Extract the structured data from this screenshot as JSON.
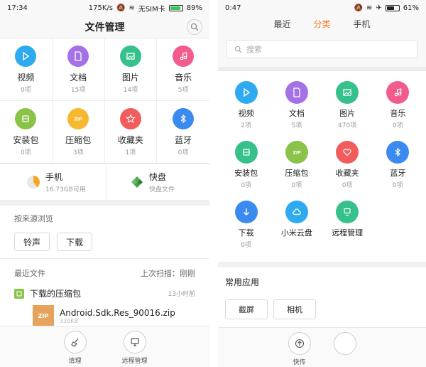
{
  "left": {
    "status": {
      "time": "17:34",
      "speed": "175K/s",
      "sim": "无SIM卡",
      "battery": "89%",
      "battery_level": 0.89
    },
    "header": {
      "title": "文件管理"
    },
    "categories": [
      {
        "label": "视频",
        "count": "0项",
        "icon": "play-icon",
        "color": "#2eaaf0"
      },
      {
        "label": "文档",
        "count": "15项",
        "icon": "document-icon",
        "color": "#a472e6"
      },
      {
        "label": "图片",
        "count": "14项",
        "icon": "picture-icon",
        "color": "#36c08a"
      },
      {
        "label": "音乐",
        "count": "5项",
        "icon": "music-icon",
        "color": "#f25c8c"
      },
      {
        "label": "安装包",
        "count": "0项",
        "icon": "package-icon",
        "color": "#8bc34a"
      },
      {
        "label": "压缩包",
        "count": "3项",
        "icon": "zip-icon",
        "color": "#f5b82e"
      },
      {
        "label": "收藏夹",
        "count": "1项",
        "icon": "star-icon",
        "color": "#f25c5c"
      },
      {
        "label": "蓝牙",
        "count": "0项",
        "icon": "bluetooth-icon",
        "color": "#3b8af0"
      }
    ],
    "storage": [
      {
        "title": "手机",
        "sub": "16.73GB可用",
        "icon": "storage-pie-icon"
      },
      {
        "title": "快盘",
        "sub": "快盘文件",
        "icon": "kuaipan-logo-icon"
      }
    ],
    "source": {
      "title": "按来源浏览",
      "chips": [
        "铃声",
        "下载"
      ]
    },
    "recent": {
      "title": "最近文件",
      "scan": "上次扫描：刚刚",
      "group_title": "下载的压缩包",
      "group_time": "13小时前",
      "file_name": "Android.Sdk.Res_90016.zip",
      "file_size": "339KB",
      "zip_label": "ZIP"
    },
    "bottom": [
      {
        "label": "清理",
        "icon": "broom-icon"
      },
      {
        "label": "远程管理",
        "icon": "remote-monitor-icon"
      }
    ]
  },
  "right": {
    "status": {
      "time": "0:47",
      "battery": "61%",
      "battery_level": 0.61
    },
    "tabs": [
      "最近",
      "分类",
      "手机"
    ],
    "active_tab": "分类",
    "search_placeholder": "搜索",
    "categories": [
      {
        "label": "视频",
        "count": "2项",
        "icon": "play-icon",
        "color": "#2eaaf0"
      },
      {
        "label": "文档",
        "count": "5项",
        "icon": "document-icon",
        "color": "#a472e6"
      },
      {
        "label": "图片",
        "count": "470项",
        "icon": "picture-icon",
        "color": "#36c08a"
      },
      {
        "label": "音乐",
        "count": "0项",
        "icon": "music-icon",
        "color": "#f25c8c"
      },
      {
        "label": "安装包",
        "count": "0项",
        "icon": "package-icon",
        "color": "#36c08a"
      },
      {
        "label": "压缩包",
        "count": "0项",
        "icon": "zip-icon",
        "color": "#8bc34a"
      },
      {
        "label": "收藏夹",
        "count": "0项",
        "icon": "heart-icon",
        "color": "#f25c5c"
      },
      {
        "label": "蓝牙",
        "count": "0项",
        "icon": "bluetooth-icon",
        "color": "#3b8af0"
      },
      {
        "label": "下载",
        "count": "0项",
        "icon": "download-icon",
        "color": "#3b8af0"
      },
      {
        "label": "小米云盘",
        "count": "",
        "icon": "cloud-icon",
        "color": "#2eaaf0"
      },
      {
        "label": "远程管理",
        "count": "",
        "icon": "remote-icon",
        "color": "#36c08a"
      }
    ],
    "apps": {
      "title": "常用应用",
      "chips": [
        "截屏",
        "相机"
      ]
    },
    "bottom": [
      {
        "label": "快传",
        "icon": "upload-icon"
      }
    ]
  }
}
